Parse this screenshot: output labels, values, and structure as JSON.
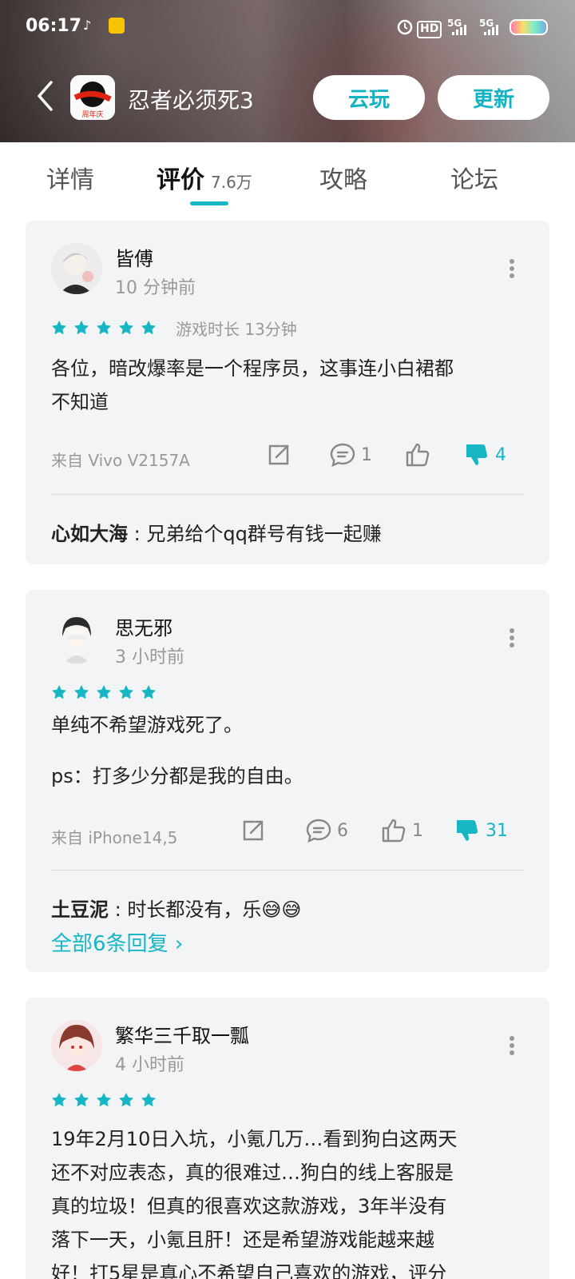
{
  "status_bar": {
    "time": "06:17",
    "icons": [
      "tiktok-icon",
      "app-notify-icon",
      "alarm-icon",
      "hd-icon",
      "signal-5g-icon",
      "signal-5g-icon",
      "battery-icon"
    ],
    "hd_label": "HD",
    "net1": "5G",
    "net2": "5G"
  },
  "header": {
    "app_title": "忍者必须死3",
    "cloud_play": "云玩",
    "update": "更新"
  },
  "tabs": [
    {
      "label": "详情"
    },
    {
      "label": "评价",
      "count": "7.6万",
      "active": true
    },
    {
      "label": "攻略"
    },
    {
      "label": "论坛"
    }
  ],
  "colors": {
    "accent": "#16b6c4",
    "card_bg": "#f3f4f6"
  },
  "reviews": [
    {
      "username": "皆傅",
      "time": "10 分钟前",
      "stars": 5,
      "playtime": "游戏时长 13分钟",
      "lines": [
        "各位，暗改爆率是一个程序员，这事连小白裙都",
        "不知道"
      ],
      "device": "来自 Vivo V2157A",
      "comments": "1",
      "likes": "",
      "dislikes": "4",
      "reply_user": "心如大海",
      "reply_text": "兄弟给个qq群号有钱一起赚"
    },
    {
      "username": "思无邪",
      "time": "3 小时前",
      "stars": 5,
      "line1": "单纯不希望游戏死了。",
      "line2": "ps：打多少分都是我的自由。",
      "device": "来自 iPhone14,5",
      "comments": "6",
      "likes": "1",
      "dislikes": "31",
      "reply_user": "土豆泥",
      "reply_text": "时长都没有，乐😅😅",
      "more_replies": "全部6条回复"
    },
    {
      "username": "繁华三千取一瓢",
      "time": "4 小时前",
      "stars": 5,
      "lines": [
        "19年2月10日入坑，小氪几万…看到狗白这两天",
        "还不对应表态，真的很难过…狗白的线上客服是",
        "真的垃圾！但真的很喜欢这款游戏，3年半没有",
        "落下一天，小氪且肝！还是希望游戏能越来越",
        "好！打5星是真心不希望自己喜欢的游戏，评分"
      ]
    }
  ]
}
